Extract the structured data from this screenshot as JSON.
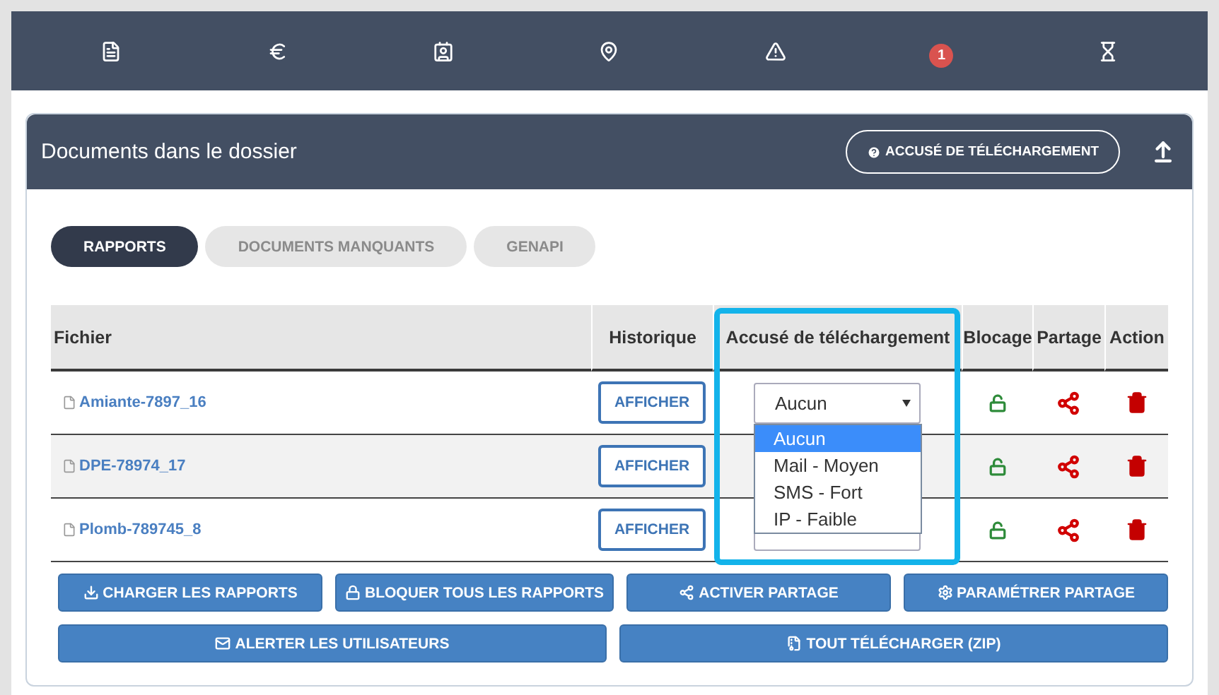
{
  "nav": {
    "items": [
      {
        "kind": "document"
      },
      {
        "kind": "euro"
      },
      {
        "kind": "contact"
      },
      {
        "kind": "pin"
      },
      {
        "kind": "warning"
      },
      {
        "kind": "badge",
        "badge": "1"
      },
      {
        "kind": "hourglass"
      }
    ]
  },
  "panel": {
    "title": "Documents dans le dossier",
    "header_button": "ACCUSÉ DE TÉLÉCHARGEMENT"
  },
  "tabs": [
    {
      "label": "RAPPORTS",
      "selected": true
    },
    {
      "label": "DOCUMENTS MANQUANTS",
      "selected": false
    },
    {
      "label": "GENAPI",
      "selected": false
    }
  ],
  "table": {
    "columns": [
      "Fichier",
      "Historique",
      "Accusé de téléchargement",
      "Blocage",
      "Partage",
      "Action"
    ],
    "rows": [
      {
        "file": "Amiante-7897_16",
        "history": "AFFICHER",
        "acknowledgement": "Aucun",
        "locked": false
      },
      {
        "file": "DPE-78974_17",
        "history": "AFFICHER",
        "locked": false,
        "select_hidden": true
      },
      {
        "file": "Plomb-789745_8",
        "history": "AFFICHER",
        "locked": false
      }
    ]
  },
  "dropdown": {
    "options": [
      {
        "label": "Aucun",
        "selected": true
      },
      {
        "label": "Mail - Moyen",
        "selected": false
      },
      {
        "label": "SMS - Fort",
        "selected": false
      },
      {
        "label": "IP - Faible",
        "selected": false
      }
    ]
  },
  "button_rows": [
    [
      {
        "label": "CHARGER LES RAPPORTS",
        "kind": "download"
      },
      {
        "label": "BLOQUER TOUS LES RAPPORTS",
        "kind": "lock"
      },
      {
        "label": "ACTIVER PARTAGE",
        "kind": "share"
      },
      {
        "label": "PARAMÉTRER PARTAGE",
        "kind": "cogs"
      }
    ],
    [
      {
        "label": "ALERTER LES UTILISATEURS",
        "kind": "mail"
      },
      {
        "label": "TOUT TÉLÉCHARGER (ZIP)",
        "kind": "zip"
      }
    ]
  ]
}
